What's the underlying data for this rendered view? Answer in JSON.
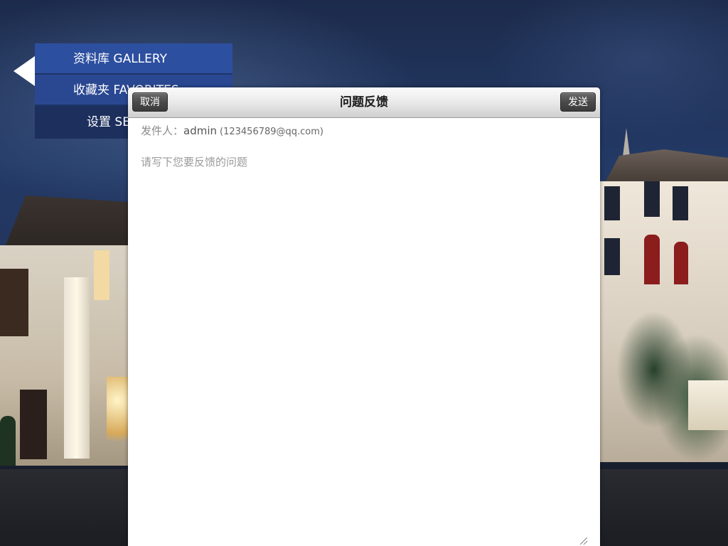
{
  "menu": {
    "items": [
      {
        "label": "资料库 GALLERY"
      },
      {
        "label": "收藏夹 FAVORITES"
      },
      {
        "label": "设置 SETTINGS"
      }
    ]
  },
  "dialog": {
    "title": "问题反馈",
    "cancel_label": "取消",
    "send_label": "发送",
    "sender_label": "发件人：",
    "sender_name": "admin",
    "sender_email": "(123456789@qq.com)",
    "feedback_placeholder": "请写下您要反馈的问题",
    "feedback_value": ""
  },
  "colors": {
    "menu_active": "#2d4fa0",
    "menu_dark": "#1c2f5d",
    "header_button": "#4a4a4a"
  },
  "icons": {
    "back": "back-arrow-icon",
    "resize": "resize-grip-icon"
  }
}
